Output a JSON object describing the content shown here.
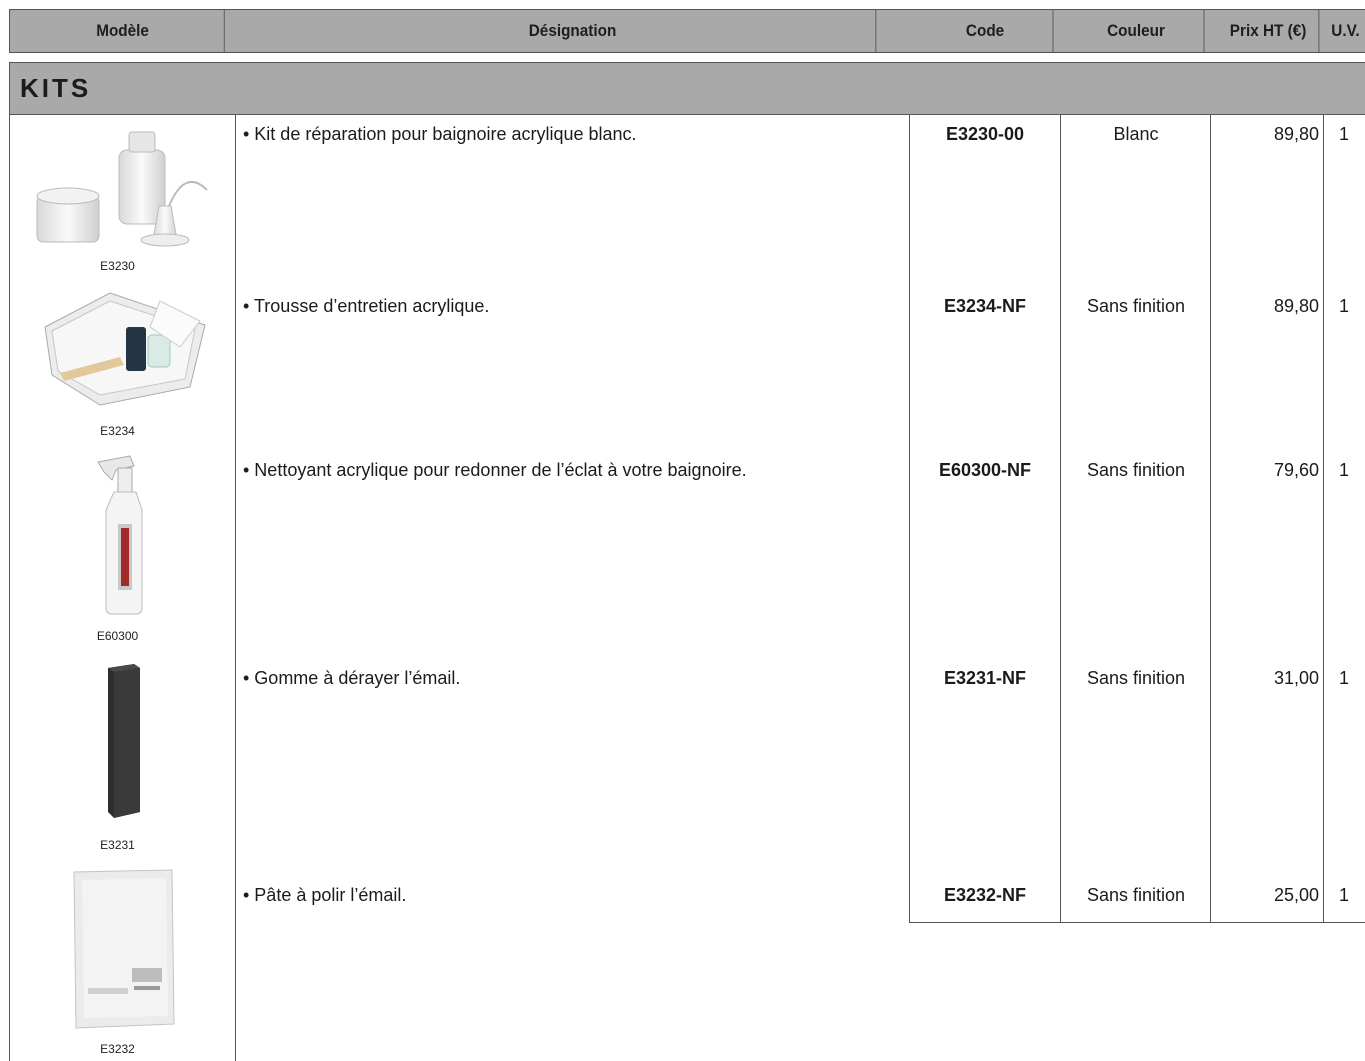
{
  "header": {
    "modele": "Modèle",
    "designation": "Désignation",
    "code": "Code",
    "couleur": "Couleur",
    "prix": "Prix HT (€)",
    "uv": "U.V."
  },
  "section": {
    "title": "KITS"
  },
  "rows": [
    {
      "model": "E3230",
      "designation": "• Kit de réparation pour baignoire acrylique blanc.",
      "code": "E3230-00",
      "couleur": "Blanc",
      "prix": "89,80",
      "uv": "1"
    },
    {
      "model": "E3234",
      "designation": "• Trousse d’entretien acrylique.",
      "code": "E3234-NF",
      "couleur": "Sans finition",
      "prix": "89,80",
      "uv": "1"
    },
    {
      "model": "E60300",
      "designation": "• Nettoyant acrylique pour redonner de l’éclat à votre baignoire.",
      "code": "E60300-NF",
      "couleur": "Sans finition",
      "prix": "79,60",
      "uv": "1"
    },
    {
      "model": "E3231",
      "designation": "• Gomme à dérayer l’émail.",
      "code": "E3231-NF",
      "couleur": "Sans finition",
      "prix": "31,00",
      "uv": "1"
    },
    {
      "model": "E3232",
      "designation": "• Pâte à polir l’émail.",
      "code": "E3232-NF",
      "couleur": "Sans finition",
      "prix": "25,00",
      "uv": "1"
    }
  ]
}
